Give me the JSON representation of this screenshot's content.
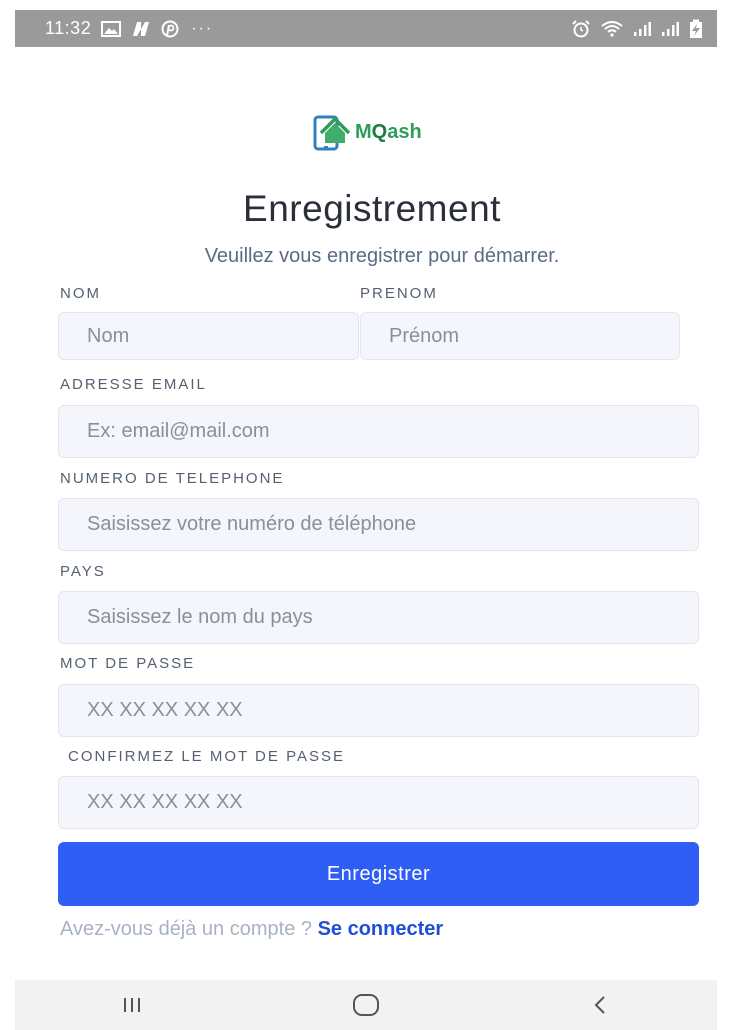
{
  "status_bar": {
    "time": "11:32",
    "more": "···"
  },
  "logo": {
    "text_m": "M",
    "text_q": "Q",
    "text_rest": "ash"
  },
  "page": {
    "title": "Enregistrement",
    "subtitle": "Veuillez vous enregistrer pour démarrer."
  },
  "form": {
    "nom": {
      "label": "NOM",
      "placeholder": "Nom",
      "value": ""
    },
    "prenom": {
      "label": "PRENOM",
      "placeholder": "Prénom",
      "value": ""
    },
    "email": {
      "label": "ADRESSE EMAIL",
      "placeholder": "Ex: email@mail.com",
      "value": ""
    },
    "phone": {
      "label": "NUMERO DE TELEPHONE",
      "placeholder": "Saisissez votre numéro de téléphone",
      "value": ""
    },
    "country": {
      "label": "PAYS",
      "placeholder": "Saisissez le nom du pays",
      "value": ""
    },
    "password": {
      "label": "MOT DE PASSE",
      "placeholder": "XX XX XX XX XX",
      "value": ""
    },
    "confirm_password": {
      "label": "CONFIRMEZ LE MOT DE PASSE",
      "placeholder": "XX XX XX XX XX",
      "value": ""
    },
    "submit_label": "Enregistrer"
  },
  "login": {
    "prompt": "Avez-vous déjà un compte ? ",
    "link": "Se connecter"
  },
  "colors": {
    "primary": "#2f5ef5",
    "link": "#1f4fd8",
    "brand_green": "#2e9d5a"
  }
}
